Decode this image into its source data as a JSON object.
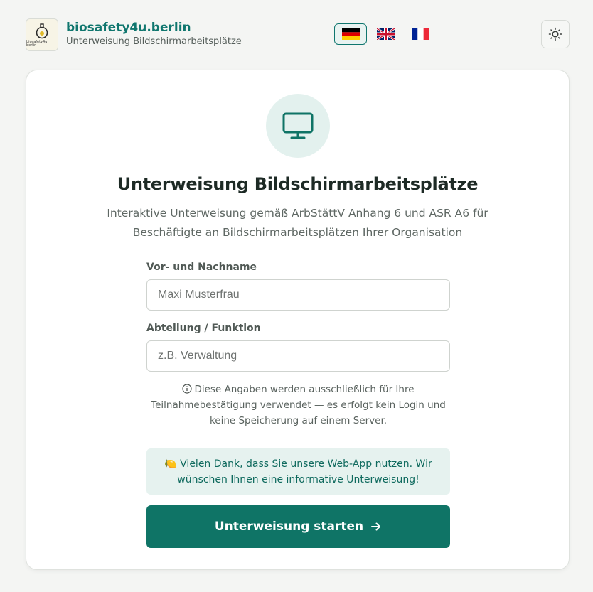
{
  "header": {
    "logo_text": "biosafety4u berlin",
    "brand_title": "biosafety4u.berlin",
    "brand_subtitle": "Unterweisung Bildschirmarbeitsplätze",
    "languages": [
      {
        "code": "de",
        "icon": "flag-germany-icon",
        "active": true
      },
      {
        "code": "en",
        "icon": "flag-uk-icon",
        "active": false
      },
      {
        "code": "fr",
        "icon": "flag-france-icon",
        "active": false
      }
    ],
    "theme_icon": "sun-icon"
  },
  "card": {
    "hero_icon": "monitor-icon",
    "title": "Unterweisung Bildschirmarbeitsplätze",
    "description": "Interaktive Unterweisung gemäß ArbStättV Anhang 6 und ASR A6 für Beschäftigte an Bildschirmarbeitsplätzen Ihrer Organisation",
    "name_label": "Vor- und Nachname",
    "name_placeholder": "Maxi Musterfrau",
    "department_label": "Abteilung / Funktion",
    "department_placeholder": "z.B. Verwaltung",
    "info_text": "Diese Angaben werden ausschließlich für Ihre Teilnahmebestätigung verwendet — es erfolgt kein Login und keine Speicherung auf einem Server.",
    "thanks_emoji": "🍋",
    "thanks_text": "Vielen Dank, dass Sie unsere Web-App nutzen. Wir wünschen Ihnen eine informative Unterweisung!",
    "start_button": "Unterweisung starten"
  },
  "colors": {
    "accent": "#0f7466",
    "accent_light": "#e3f1ee",
    "background": "#f4f5f3"
  }
}
